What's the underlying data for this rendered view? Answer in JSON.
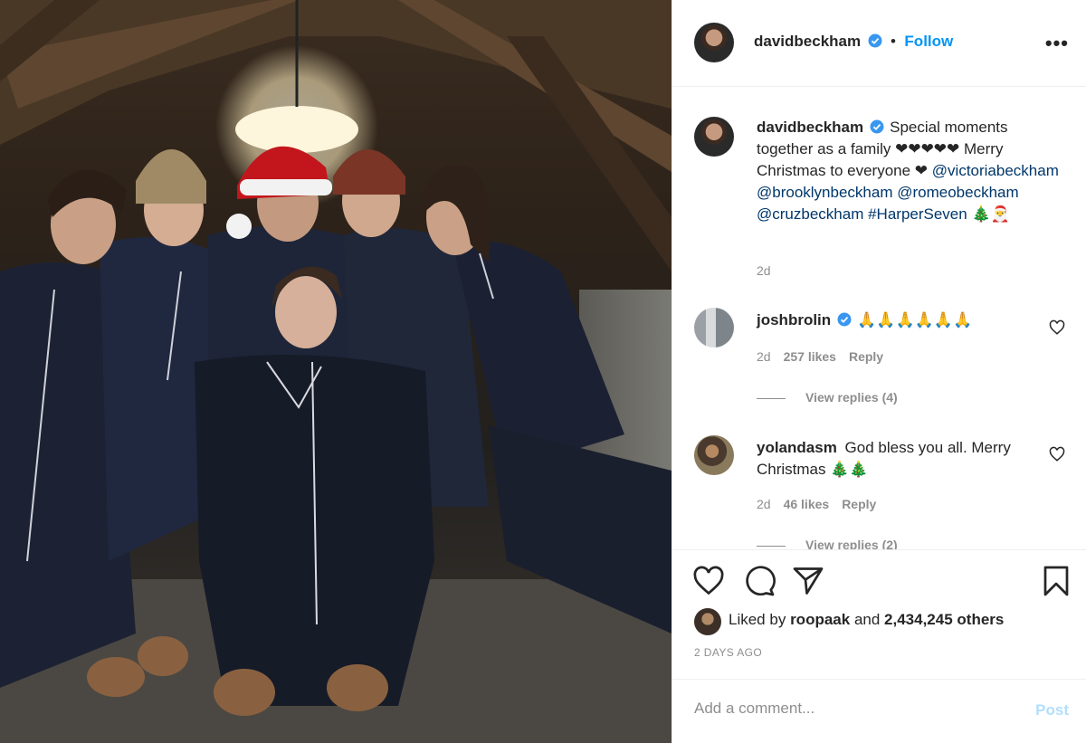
{
  "post": {
    "image_alt": "Beckham family in matching pyjamas",
    "header": {
      "username": "davidbeckham",
      "follow_label": "Follow",
      "dot": "•",
      "more_icon": "more-options-icon"
    },
    "caption": {
      "username": "davidbeckham",
      "text": "Special moments together as a family ❤❤❤❤❤ Merry Christmas to everyone ❤",
      "mentions": [
        "@victoriabeckham",
        "@brooklynbeckham",
        "@romeobeckham",
        "@cruzbeckham"
      ],
      "hashtag": "#HarperSeven",
      "emoji_tail": "🎄🎅",
      "time": "2d"
    },
    "comments": [
      {
        "username": "joshbrolin",
        "verified": true,
        "text": "🙏🙏🙏🙏🙏🙏",
        "time": "2d",
        "likes": "257 likes",
        "reply": "Reply",
        "view_replies": "View replies (4)"
      },
      {
        "username": "yolandasm",
        "verified": false,
        "text": "God bless you all. Merry Christmas 🎄🎄",
        "time": "2d",
        "likes": "46 likes",
        "reply": "Reply",
        "view_replies": "View replies (2)"
      }
    ],
    "likes": {
      "prefix": "Liked by",
      "user": "roopaak",
      "middle": "and",
      "others": "2,434,245 others"
    },
    "date": "2 DAYS AGO",
    "add_comment": {
      "placeholder": "Add a comment...",
      "post_label": "Post"
    },
    "colors": {
      "link_blue": "#0095f6",
      "tag_blue": "#00376b",
      "muted": "#8e8e8e",
      "post_disabled": "#b2dffc"
    }
  }
}
